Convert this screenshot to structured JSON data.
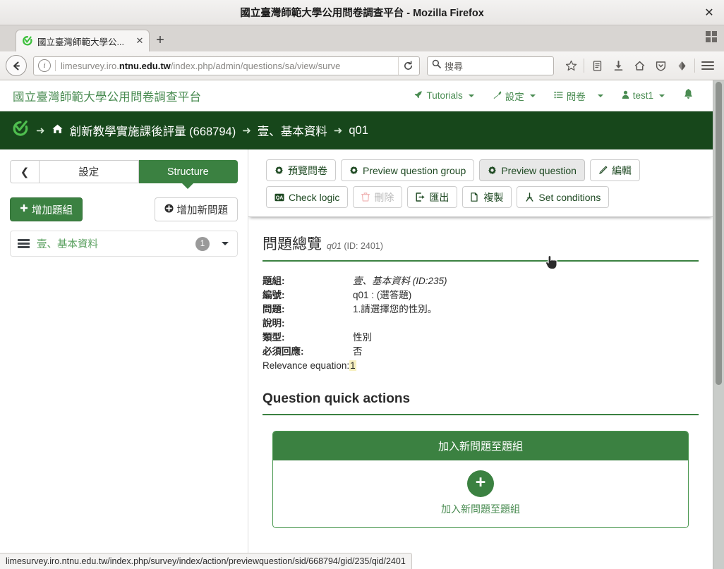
{
  "browser": {
    "window_title": "國立臺灣師範大學公用問卷調查平台 - Mozilla Firefox",
    "close_label": "✕",
    "tab": {
      "title": "國立臺灣師範大學公...",
      "close_label": "✕",
      "favicon": "limesurvey-favicon"
    },
    "new_tab_label": "+",
    "url_prefix": "limesurvey.iro.",
    "url_domain": "ntnu.edu.tw",
    "url_suffix": "/index.php/admin/questions/sa/view/surve",
    "reload_label": "⟳",
    "search_placeholder": "搜尋",
    "back_label": "←",
    "icons": [
      "star-icon",
      "library-icon",
      "download-icon",
      "home-icon",
      "shield-icon",
      "pocket-icon",
      "menu-icon"
    ]
  },
  "topbar": {
    "brand": "國立臺灣師範大學公用問卷調查平台",
    "nav": [
      {
        "label": "Tutorials",
        "icon": "rocket-icon",
        "caret": true
      },
      {
        "label": "設定",
        "icon": "wrench-icon",
        "caret": true
      },
      {
        "label": "問卷",
        "icon": "list-icon",
        "caret": true
      },
      {
        "label": "test1",
        "icon": "user-icon",
        "caret": true
      }
    ],
    "bell_icon": "bell-icon"
  },
  "breadcrumb": {
    "logo": "limesurvey-logo",
    "arrow": "➜",
    "home_icon": "home-icon",
    "items": [
      "創新教學實施課後評量 (668794)",
      "壹、基本資料",
      "q01"
    ]
  },
  "sidebar": {
    "collapse_label": "❮",
    "tabs": [
      {
        "label": "設定",
        "active": false
      },
      {
        "label": "Structure",
        "active": true
      }
    ],
    "add_group_label": "增加題組",
    "add_group_icon": "plus-icon",
    "add_question_label": "增加新問題",
    "add_question_icon": "plus-circle-icon",
    "groups": [
      {
        "name": "壹、基本資料",
        "count": "1",
        "grip_icon": "drag-handle-icon",
        "caret_icon": "chevron-down-icon"
      }
    ]
  },
  "toolbar": {
    "row1": [
      {
        "label": "預覽問卷",
        "icon": "gear-icon",
        "state": "normal"
      },
      {
        "label": "Preview question group",
        "icon": "gear-icon",
        "state": "normal"
      },
      {
        "label": "Preview question",
        "icon": "gear-icon",
        "state": "active"
      },
      {
        "label": "編輯",
        "icon": "pencil-icon",
        "state": "normal"
      }
    ],
    "row2": [
      {
        "label": "Check logic",
        "icon": "logic-icon",
        "state": "normal"
      },
      {
        "label": "刪除",
        "icon": "trash-icon",
        "state": "danger"
      },
      {
        "label": "匯出",
        "icon": "export-icon",
        "state": "normal"
      },
      {
        "label": "複製",
        "icon": "copy-icon",
        "state": "normal"
      },
      {
        "label": "Set conditions",
        "icon": "branch-icon",
        "state": "normal"
      }
    ]
  },
  "overview": {
    "title": "問題總覽",
    "subtitle_code": "q01",
    "subtitle_id": "(ID: 2401)",
    "rows": [
      {
        "key": "題組:",
        "value": "壹、基本資料 (ID:235)",
        "italic": true
      },
      {
        "key": "編號:",
        "value": "q01 : (選答題)",
        "italic": false
      },
      {
        "key": "問題:",
        "value": "1.請選擇您的性別。",
        "italic": false
      },
      {
        "key": "說明:",
        "value": "",
        "italic": false
      },
      {
        "key": "類型:",
        "value": "性別",
        "italic": false
      },
      {
        "key": "必須回應:",
        "value": "否",
        "italic": false
      }
    ],
    "relevance_key": "Relevance equation:",
    "relevance_value": "1"
  },
  "quick_actions": {
    "title": "Question quick actions",
    "card": {
      "header": "加入新問題至題組",
      "plus_icon": "plus-icon",
      "label": "加入新問題至題組"
    }
  },
  "statusbar": {
    "text": "limesurvey.iro.ntnu.edu.tw/index.php/survey/index/action/previewquestion/sid/668794/gid/235/qid/2401"
  },
  "colors": {
    "brand_green": "#4a8c52",
    "dark_green": "#17471b",
    "button_green": "#3b8141",
    "highlight_yellow": "#f7f0c0"
  }
}
